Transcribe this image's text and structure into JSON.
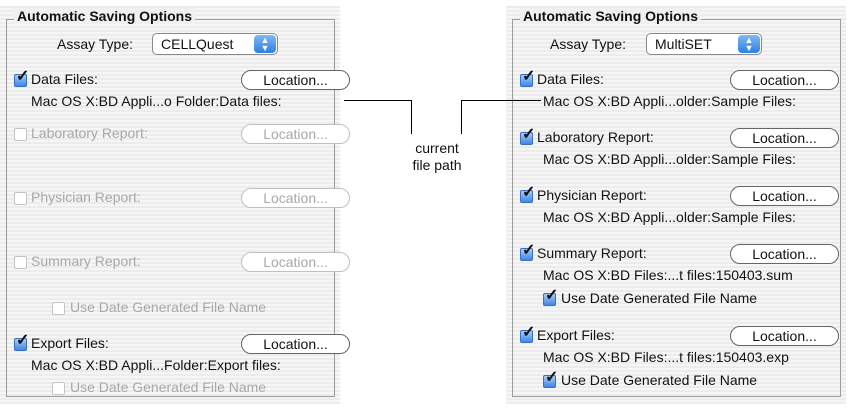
{
  "left": {
    "title": "Automatic Saving Options",
    "assay_label": "Assay Type:",
    "assay_value": "CELLQuest",
    "data_files": {
      "label": "Data Files:",
      "button": "Location...",
      "path": "Mac OS X:BD Appli...o Folder:Data files:"
    },
    "lab_report": {
      "label": "Laboratory Report:",
      "button": "Location..."
    },
    "physician_report": {
      "label": "Physician Report:",
      "button": "Location..."
    },
    "summary_report": {
      "label": "Summary Report:",
      "button": "Location..."
    },
    "use_date_1": "Use Date Generated File Name",
    "export_files": {
      "label": "Export Files:",
      "button": "Location...",
      "path": "Mac OS X:BD Appli...Folder:Export files:"
    },
    "use_date_2": "Use Date Generated File Name"
  },
  "right": {
    "title": "Automatic Saving Options",
    "assay_label": "Assay Type:",
    "assay_value": "MultiSET",
    "data_files": {
      "label": "Data Files:",
      "button": "Location...",
      "path": "Mac OS X:BD Appli...older:Sample Files:"
    },
    "lab_report": {
      "label": "Laboratory Report:",
      "button": "Location...",
      "path": "Mac OS X:BD Appli...older:Sample Files:"
    },
    "physician_report": {
      "label": "Physician Report:",
      "button": "Location...",
      "path": "Mac OS X:BD Appli...older:Sample Files:"
    },
    "summary_report": {
      "label": "Summary Report:",
      "button": "Location...",
      "path": "Mac OS X:BD Files:...t files:150403.sum"
    },
    "use_date_1": "Use Date Generated File Name",
    "export_files": {
      "label": "Export Files:",
      "button": "Location...",
      "path": "Mac OS X:BD Files:...t files:150403.exp"
    },
    "use_date_2": "Use Date Generated File Name"
  },
  "callout": {
    "line1": "current",
    "line2": "file path"
  },
  "colors": {
    "accent": "#3f86e5",
    "disabled_text": "#a8a8a8"
  }
}
